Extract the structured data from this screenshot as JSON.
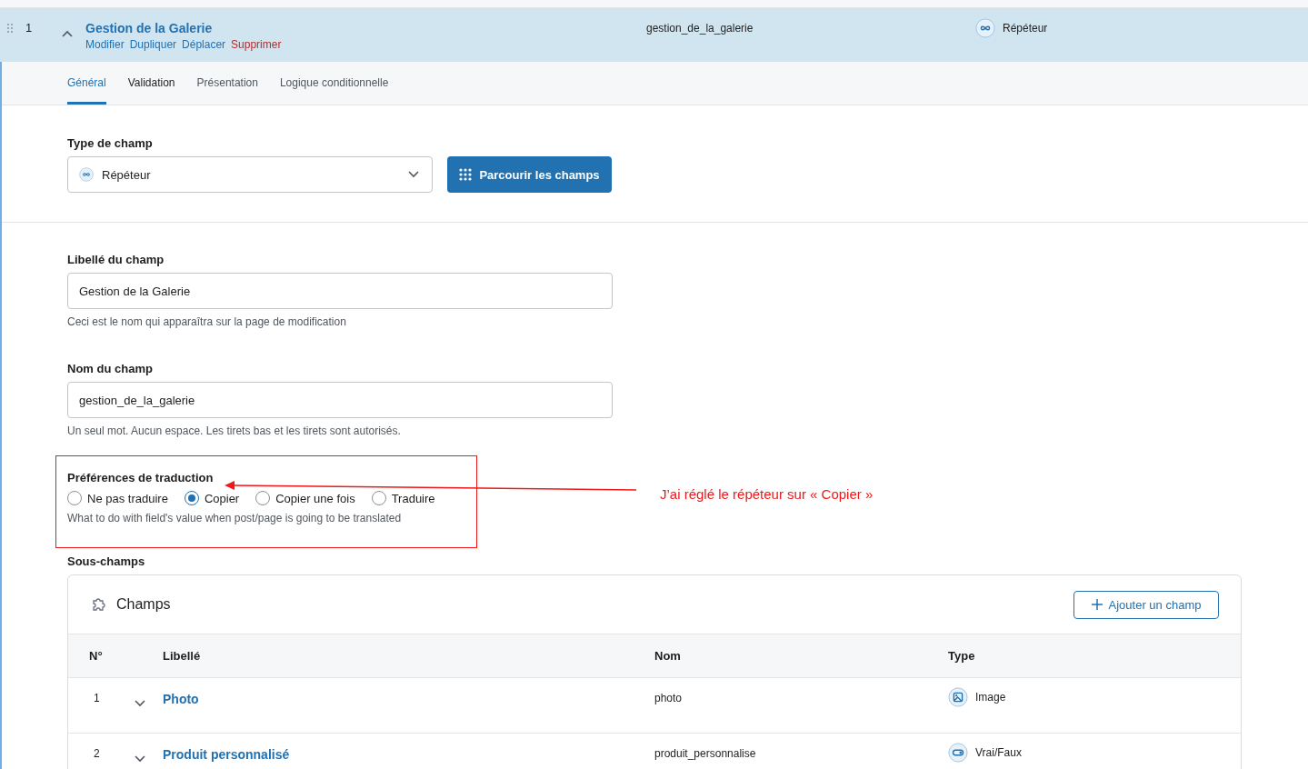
{
  "field": {
    "number": "1",
    "label": "Gestion de la Galerie",
    "expanded": true,
    "name": "gestion_de_la_galerie",
    "type": {
      "label": "Répéteur",
      "kind": "repeater"
    },
    "actions": [
      {
        "label": "Modifier",
        "kind": "link"
      },
      {
        "label": "Dupliquer",
        "kind": "link"
      },
      {
        "label": "Déplacer",
        "kind": "link"
      },
      {
        "label": "Supprimer",
        "kind": "danger"
      }
    ]
  },
  "tabs": [
    {
      "label": "Général",
      "selected": true
    },
    {
      "label": "Validation",
      "selected": false
    },
    {
      "label": "Présentation",
      "selected": false
    },
    {
      "label": "Logique conditionnelle",
      "selected": false
    }
  ],
  "field_type": {
    "label": "Type de champ",
    "value": "Répéteur",
    "kind": "repeater",
    "browse_button": "Parcourir les champs"
  },
  "field_label": {
    "label": "Libellé du champ",
    "value": "Gestion de la Galerie",
    "hint": "Ceci est le nom qui apparaîtra sur la page de modification"
  },
  "field_name": {
    "label": "Nom du champ",
    "value": "gestion_de_la_galerie",
    "hint": "Un seul mot. Aucun espace. Les tirets bas et les tirets sont autorisés."
  },
  "translation": {
    "label": "Préférences de traduction",
    "hint": "What to do with field's value when post/page is going to be translated",
    "options": [
      {
        "label": "Ne pas traduire",
        "selected": false
      },
      {
        "label": "Copier",
        "selected": true
      },
      {
        "label": "Copier une fois",
        "selected": false
      },
      {
        "label": "Traduire",
        "selected": false
      }
    ]
  },
  "subfields": {
    "label": "Sous-champs",
    "title": "Champs",
    "add_button": "Ajouter un champ",
    "columns": [
      "N°",
      "Libellé",
      "Nom",
      "Type"
    ],
    "rows": [
      {
        "number": "1",
        "label": "Photo",
        "name": "photo",
        "expanded": false,
        "type": {
          "label": "Image",
          "kind": "image"
        }
      },
      {
        "number": "2",
        "label": "Produit personnalisé",
        "name": "produit_personnalise",
        "expanded": false,
        "type": {
          "label": "Vrai/Faux",
          "kind": "toggle"
        }
      }
    ]
  },
  "annotation": {
    "note": "J’ai réglé le répéteur sur « Copier »"
  }
}
